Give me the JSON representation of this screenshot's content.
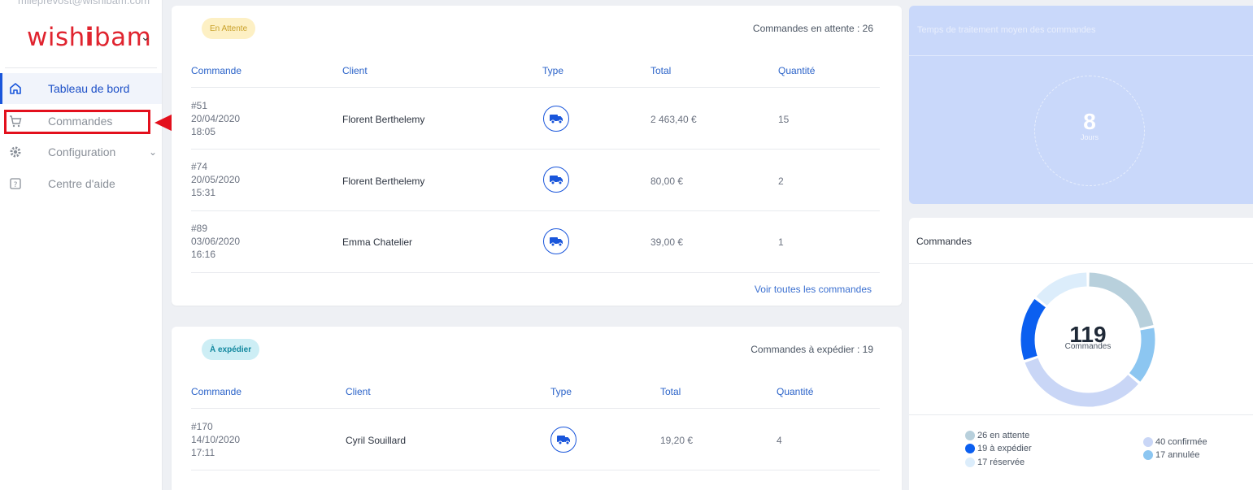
{
  "sidebar": {
    "email": "mlleprevost@wishibam.com",
    "logo_left": "wish",
    "logo_bold": "i",
    "logo_right": "bam",
    "items": [
      {
        "label": "Tableau de bord",
        "icon": "home-icon"
      },
      {
        "label": "Commandes",
        "icon": "cart-icon"
      },
      {
        "label": "Configuration",
        "icon": "gear-icon"
      },
      {
        "label": "Centre d'aide",
        "icon": "help-icon"
      }
    ]
  },
  "colors": {
    "accent": "#1a56db",
    "brand": "#e0242f",
    "highlight": "#e3101d"
  },
  "pending": {
    "badge": "En Attente",
    "count": "Commandes en attente : 26",
    "headers": [
      "Commande",
      "Client",
      "Type",
      "Total",
      "Quantité"
    ],
    "rows": [
      {
        "id": "#51",
        "date": "20/04/2020",
        "time": "18:05",
        "client": "Florent Berthelemy",
        "total": "2 463,40 €",
        "qty": "15"
      },
      {
        "id": "#74",
        "date": "20/05/2020",
        "time": "15:31",
        "client": "Florent Berthelemy",
        "total": "80,00 €",
        "qty": "2"
      },
      {
        "id": "#89",
        "date": "03/06/2020",
        "time": "16:16",
        "client": "Emma Chatelier",
        "total": "39,00 €",
        "qty": "1"
      }
    ],
    "see_all": "Voir toutes les commandes"
  },
  "to_ship": {
    "badge": "À expédier",
    "count": "Commandes à expédier : 19",
    "headers": [
      "Commande",
      "Client",
      "Type",
      "Total",
      "Quantité"
    ],
    "rows": [
      {
        "id": "#170",
        "date": "14/10/2020",
        "time": "17:11",
        "client": "Cyril Souillard",
        "total": "19,20 €",
        "qty": "4"
      }
    ]
  },
  "avg_time": {
    "title": "Temps de traitement moyen des commandes",
    "value": "8",
    "unit": "Jours"
  },
  "orders_chart": {
    "title": "Commandes",
    "total": "119",
    "total_label": "Commandes",
    "legend": [
      {
        "label": "26 en attente",
        "value": 26,
        "color": "#b8d0dc"
      },
      {
        "label": "19 à expédier",
        "value": 19,
        "color": "#0b5ff0"
      },
      {
        "label": "17 réservée",
        "value": 17,
        "color": "#dcedfb"
      },
      {
        "label": "40 confirmée",
        "value": 40,
        "color": "#c9d6f6"
      },
      {
        "label": "17 annulée",
        "value": 17,
        "color": "#8cc6f1"
      }
    ]
  }
}
